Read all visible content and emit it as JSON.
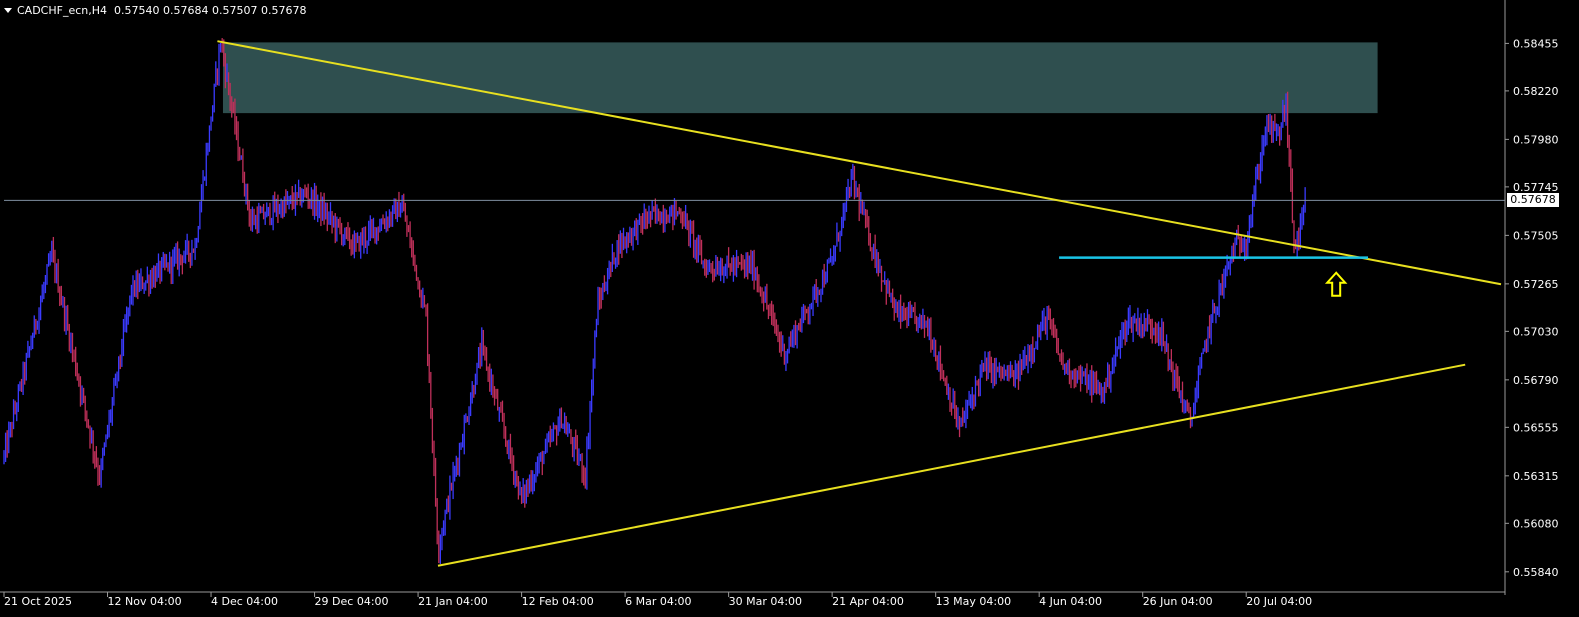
{
  "header": {
    "symbol": "CADCHF_ecn,H4",
    "ohlc": "0.57540 0.57684 0.57507 0.57678"
  },
  "current_price_label": "0.57678",
  "colors": {
    "background": "#000000",
    "axis": "#9a9a9a",
    "bull_candle": "#3b3bff",
    "bear_candle": "#c0305a",
    "trendline": "#e8e020",
    "support_line": "#19c4e6",
    "zone": "#2f4f4f",
    "arrow": "#ffff00",
    "price_line": "#7f8fa0"
  },
  "chart_data": {
    "type": "candlestick",
    "title": "CADCHF_ecn,H4",
    "ylim": [
      0.5575,
      0.5865
    ],
    "y_ticks": [
      "0.58455",
      "0.58220",
      "0.57980",
      "0.57745",
      "0.57505",
      "0.57265",
      "0.57030",
      "0.56790",
      "0.56555",
      "0.56315",
      "0.56080",
      "0.55840"
    ],
    "x_ticks": [
      "21 Oct 2025",
      "12 Nov 04:00",
      "4 Dec 04:00",
      "29 Dec 04:00",
      "21 Jan 04:00",
      "12 Feb 04:00",
      "6 Mar 04:00",
      "30 Mar 04:00",
      "21 Apr 04:00",
      "13 May 04:00",
      "4 Jun 04:00",
      "26 Jun 04:00",
      "20 Jul 04:00"
    ],
    "x_tick_bars": [
      0,
      130,
      260,
      390,
      520,
      650,
      780,
      910,
      1040,
      1170,
      1300,
      1430,
      1560
    ],
    "current_price": 0.57678,
    "price_path": [
      [
        0,
        0.5641
      ],
      [
        60,
        0.5741
      ],
      [
        120,
        0.5631
      ],
      [
        160,
        0.5723
      ],
      [
        240,
        0.5745
      ],
      [
        272,
        0.5847
      ],
      [
        310,
        0.5757
      ],
      [
        380,
        0.5771
      ],
      [
        440,
        0.5745
      ],
      [
        500,
        0.5765
      ],
      [
        530,
        0.571
      ],
      [
        545,
        0.5596
      ],
      [
        600,
        0.5695
      ],
      [
        650,
        0.562
      ],
      [
        700,
        0.566
      ],
      [
        730,
        0.5632
      ],
      [
        745,
        0.5715
      ],
      [
        770,
        0.5745
      ],
      [
        810,
        0.576
      ],
      [
        850,
        0.5762
      ],
      [
        880,
        0.5735
      ],
      [
        940,
        0.5735
      ],
      [
        980,
        0.5692
      ],
      [
        1040,
        0.5738
      ],
      [
        1065,
        0.5779
      ],
      [
        1090,
        0.5745
      ],
      [
        1120,
        0.5712
      ],
      [
        1160,
        0.5706
      ],
      [
        1200,
        0.5655
      ],
      [
        1230,
        0.5685
      ],
      [
        1270,
        0.568
      ],
      [
        1310,
        0.571
      ],
      [
        1330,
        0.5686
      ],
      [
        1380,
        0.5673
      ],
      [
        1410,
        0.5708
      ],
      [
        1450,
        0.5705
      ],
      [
        1470,
        0.568
      ],
      [
        1490,
        0.5658
      ],
      [
        1510,
        0.57
      ],
      [
        1525,
        0.572
      ],
      [
        1545,
        0.5745
      ],
      [
        1560,
        0.5748
      ],
      [
        1585,
        0.5805
      ],
      [
        1600,
        0.58
      ],
      [
        1610,
        0.5815
      ],
      [
        1620,
        0.5746
      ],
      [
        1627,
        0.575
      ],
      [
        1635,
        0.5768
      ]
    ],
    "zone": {
      "x1": 275,
      "x2": 1725,
      "y_low": 0.5811,
      "y_high": 0.5846
    },
    "trendlines": [
      {
        "name": "descending-resistance",
        "x1": 268,
        "y1": 0.58466,
        "x2": 1880,
        "y2": 0.57263
      },
      {
        "name": "ascending-support",
        "x1": 545,
        "y1": 0.5587,
        "x2": 1835,
        "y2": 0.56865
      }
    ],
    "support_level": {
      "x1": 1325,
      "x2": 1713,
      "y": 0.57395
    },
    "arrow": {
      "x": 1673,
      "y": 0.5732
    }
  }
}
